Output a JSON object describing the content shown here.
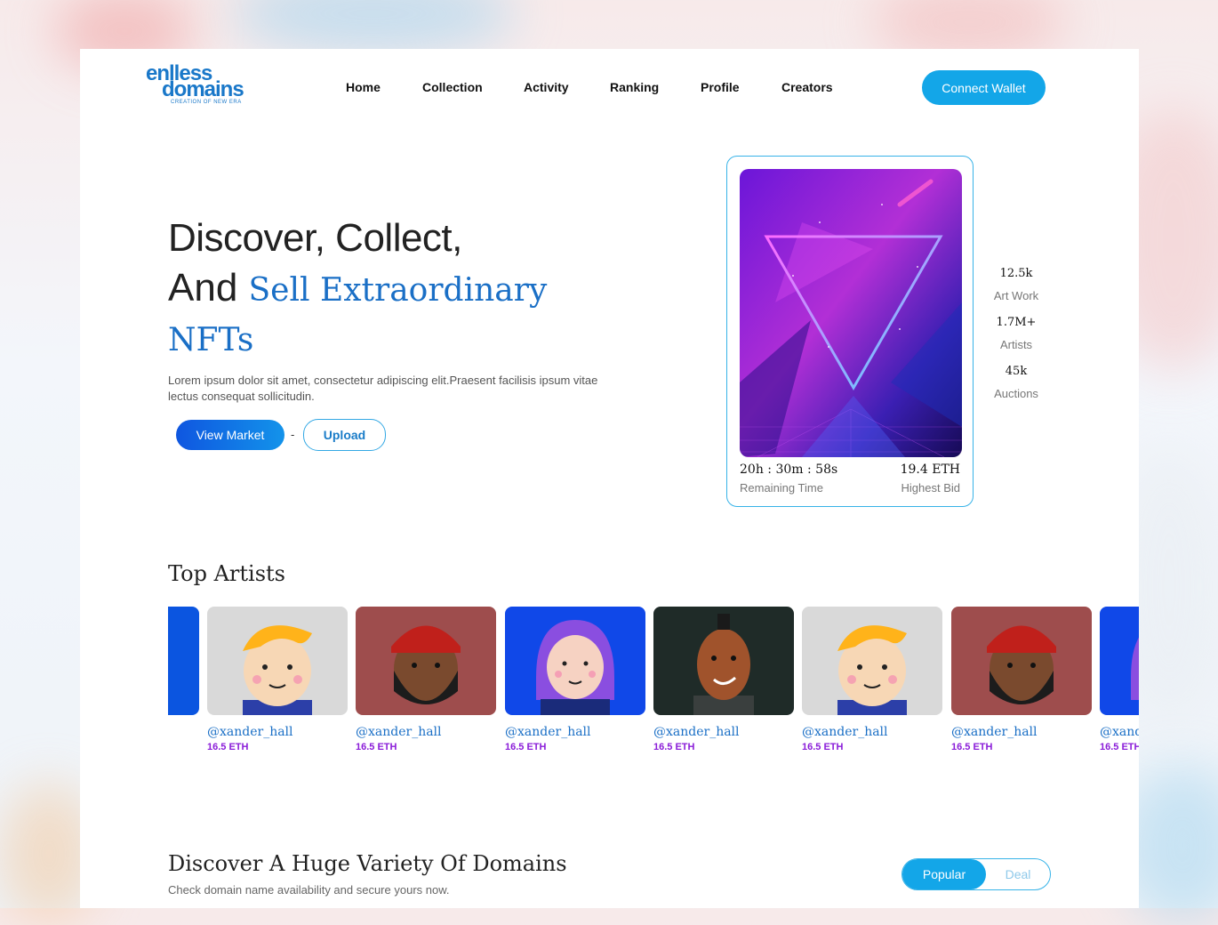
{
  "brand": {
    "logo_line1": "enlless",
    "logo_line2": "domains",
    "tagline": "CREATION OF NEW ERA"
  },
  "nav": [
    "Home",
    "Collection",
    "Activity",
    "Ranking",
    "Profile",
    "Creators"
  ],
  "header": {
    "connect_label": "Connect Wallet"
  },
  "hero": {
    "title_line1": "Discover, Collect,",
    "title_line2_prefix": "And ",
    "title_line2_highlight": "Sell Extraordinary",
    "title_line3": "NFTs",
    "description": "Lorem ipsum dolor sit amet, consectetur adipiscing elit.Praesent facilisis ipsum vitae lectus consequat sollicitudin.",
    "view_market_label": "View Market",
    "separator": "-",
    "upload_label": "Upload"
  },
  "featured_card": {
    "remaining_time": "20h : 30m : 58s",
    "remaining_time_label": "Remaining Time",
    "highest_bid": "19.4 ETH",
    "highest_bid_label": "Highest Bid"
  },
  "stats": [
    {
      "value": "12.5k",
      "label": "Art Work"
    },
    {
      "value": "1.7M+",
      "label": "Artists"
    },
    {
      "value": "45k",
      "label": "Auctions"
    }
  ],
  "top_artists": {
    "title": "Top Artists",
    "artists": [
      {
        "handle": "@xander_hall",
        "price": "16.5 ETH"
      },
      {
        "handle": "@xander_hall",
        "price": "16.5 ETH"
      },
      {
        "handle": "@xander_hall",
        "price": "16.5 ETH"
      },
      {
        "handle": "@xander_hall",
        "price": "16.5 ETH"
      },
      {
        "handle": "@xander_hall",
        "price": "16.5 ETH"
      },
      {
        "handle": "@xander_hall",
        "price": "16.5 ETH"
      },
      {
        "handle": "@xander_hall",
        "price": "16.5 ETH"
      }
    ]
  },
  "domains": {
    "title": "Discover A Huge Variety Of Domains",
    "subtitle": "Check domain name availability and secure yours now.",
    "tab_popular": "Popular",
    "tab_deal": "Deal"
  },
  "colors": {
    "accent": "#13a6e8",
    "heading_blue": "#1a6fc6",
    "eth_purple": "#8a1cd8"
  }
}
